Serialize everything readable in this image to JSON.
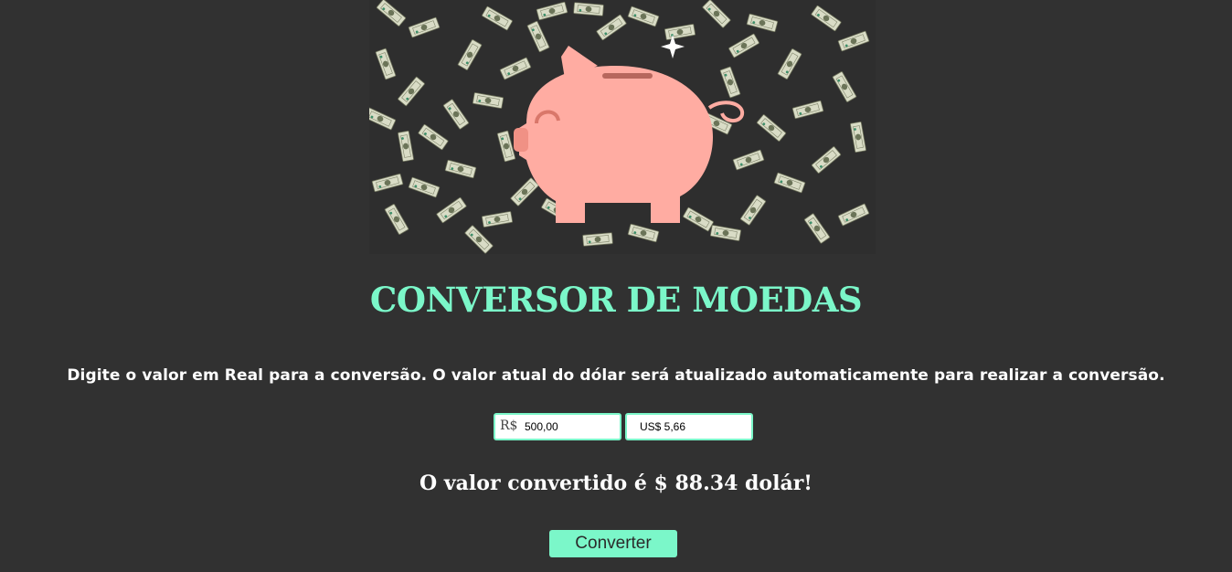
{
  "header": {
    "title": "CONVERSOR DE MOEDAS"
  },
  "instructions": "Digite o valor em Real para a conversão. O valor atual do dólar será atualizado automaticamente para realizar a conversão.",
  "form": {
    "brl": {
      "prefix": "R$",
      "value": "500,00"
    },
    "usd": {
      "value": "US$ 5,66"
    }
  },
  "result": "O valor convertido é $ 88.34 dolár!",
  "button": {
    "label": "Converter"
  },
  "colors": {
    "background": "#313131",
    "accent": "#7bf7c9",
    "piggy": "#ffaca2"
  }
}
